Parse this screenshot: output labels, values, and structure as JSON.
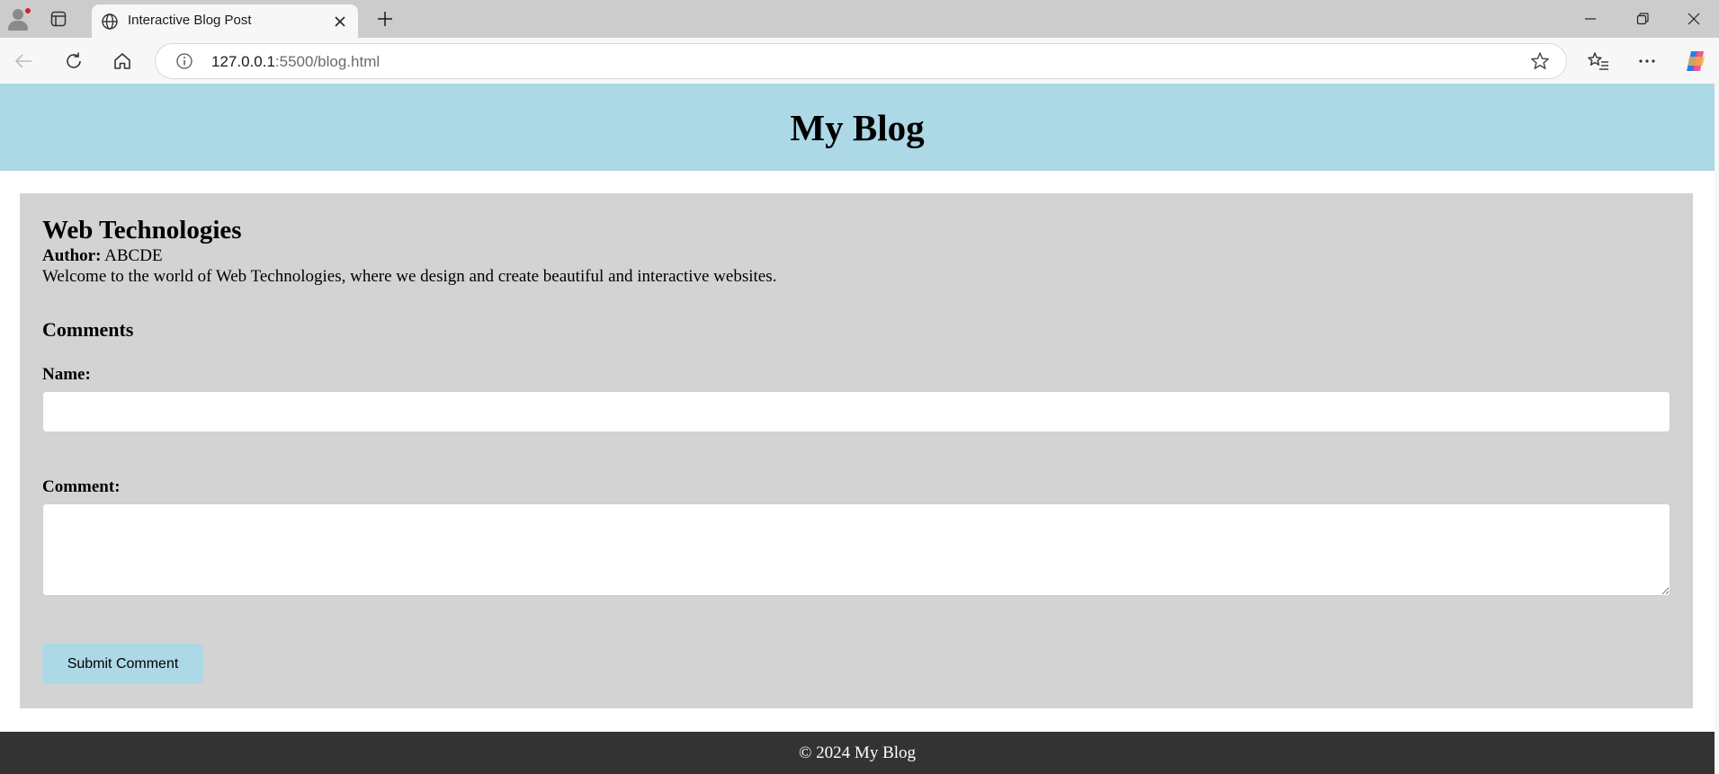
{
  "browser": {
    "tab": {
      "title": "Interactive Blog Post"
    },
    "address": {
      "host": "127.0.0.1",
      "rest": ":5500/blog.html"
    }
  },
  "page": {
    "header_title": "My Blog",
    "post": {
      "title": "Web Technologies",
      "author_label": "Author:",
      "author": "ABCDE",
      "body": "Welcome to the world of Web Technologies, where we design and create beautiful and interactive websites."
    },
    "comments": {
      "heading": "Comments",
      "name_label": "Name:",
      "name_value": "",
      "comment_label": "Comment:",
      "comment_value": "",
      "submit_label": "Submit Comment"
    },
    "footer": "© 2024 My Blog"
  },
  "colors": {
    "header_bg": "#add8e6",
    "post_bg": "#d3d3d3",
    "footer_bg": "#333333",
    "button_bg": "#add8e6"
  },
  "icons": [
    "profile-icon",
    "tab-actions-icon",
    "globe-icon",
    "close-icon",
    "plus-icon",
    "minimize-icon",
    "restore-icon",
    "window-close-icon",
    "back-icon",
    "refresh-icon",
    "home-icon",
    "info-icon",
    "star-icon",
    "favorites-icon",
    "more-icon",
    "copilot-icon"
  ]
}
